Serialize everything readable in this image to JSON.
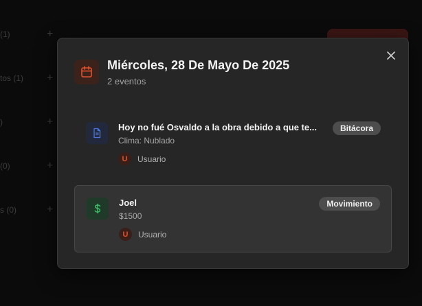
{
  "background": {
    "rows": [
      {
        "label": "(1)"
      },
      {
        "label": "tos   (1)"
      },
      {
        "label": ")"
      },
      {
        "label": "(0)"
      },
      {
        "label": "s   (0)"
      }
    ],
    "plus_glyph": "+"
  },
  "modal": {
    "icon": "calendar-icon",
    "title": "Miércoles, 28 De Mayo De 2025",
    "subtitle": "2 eventos",
    "close_glyph": "✕",
    "events": [
      {
        "icon": "document-icon",
        "title": "Hoy no fué Osvaldo a la obra debido a que te...",
        "detail": "Clima: Nublado",
        "user_initial": "U",
        "user": "Usuario",
        "badge": "Bitácora"
      },
      {
        "icon": "dollar-icon",
        "title": "Joel",
        "detail": "$1500",
        "user_initial": "U",
        "user": "Usuario",
        "badge": "Movimiento"
      }
    ]
  },
  "colors": {
    "accent": "#e0522e",
    "doc_icon": "#4a78e0",
    "money_icon": "#3cc06a"
  }
}
